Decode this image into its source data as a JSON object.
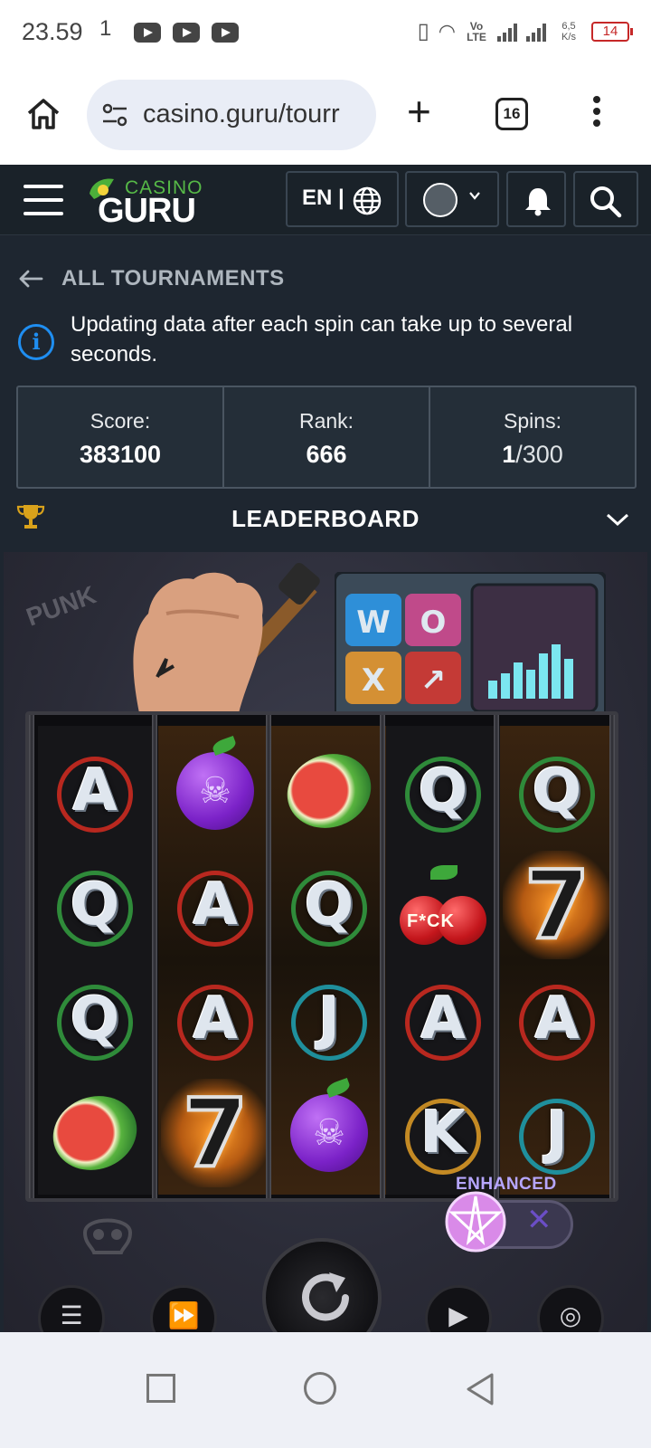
{
  "status_bar": {
    "time": "23.59",
    "time_suffix": "1",
    "network_label": "Vo LTE",
    "speed": "6,5 K/s",
    "battery": "14",
    "icons": [
      "youtube-icon",
      "youtube-icon",
      "youtube-icon",
      "vibrate-icon",
      "wifi-icon",
      "signal-icon",
      "signal-icon",
      "battery-icon"
    ]
  },
  "browser": {
    "url": "casino.guru/tourr",
    "tab_count": "16",
    "icons": [
      "home-icon",
      "site-settings-icon",
      "plus-icon",
      "tabs-icon",
      "more-vert-icon"
    ]
  },
  "site_header": {
    "logo_top": "CASINO",
    "logo_bottom": "GURU",
    "language": "EN |",
    "icons": [
      "hamburger-icon",
      "globe-icon",
      "avatar-icon",
      "chevron-down-icon",
      "bell-icon",
      "search-icon"
    ]
  },
  "tournament": {
    "back_label": "ALL TOURNAMENTS",
    "info_text": "Updating data after each spin can take up to several seconds.",
    "stats": {
      "score_label": "Score:",
      "score_value": "383100",
      "rank_label": "Rank:",
      "rank_value": "666",
      "spins_label": "Spins:",
      "spins_used": "1",
      "spins_total": "/300"
    },
    "leaderboard_label": "LEADERBOARD"
  },
  "game": {
    "graffiti": "PUNK",
    "pad_letters": [
      "W",
      "O",
      "X",
      "↗"
    ],
    "reels": [
      [
        "A",
        "Q",
        "Q",
        "watermelon"
      ],
      [
        "plum",
        "A",
        "A",
        "7"
      ],
      [
        "watermelon",
        "Q",
        "J",
        "plum"
      ],
      [
        "Q",
        "cherry",
        "A",
        "K"
      ],
      [
        "Q",
        "7",
        "A",
        "J"
      ]
    ],
    "cherry_text": "F*CK",
    "enhanced_label": "ENHANCED",
    "enhanced_off_glyph": "✕",
    "controls": [
      "menu-icon",
      "fast-forward-icon",
      "spin-icon",
      "play-icon",
      "coins-icon"
    ]
  },
  "colors": {
    "page_bg": "#1e2630",
    "header_bg": "#1a2229",
    "info_blue": "#1f8ef1",
    "logo_green": "#56b947",
    "trophy_gold": "#d9a21b"
  }
}
